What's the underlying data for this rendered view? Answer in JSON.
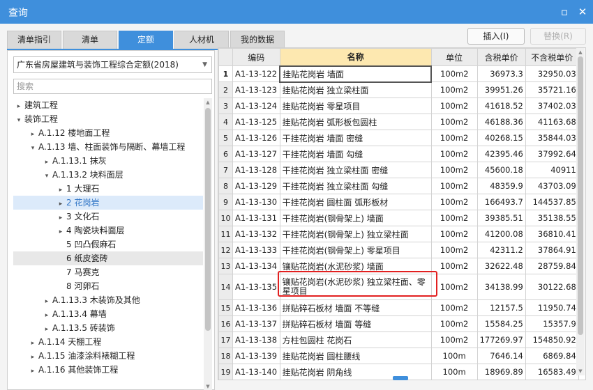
{
  "window": {
    "title": "查询",
    "restore_glyph": "▫",
    "close_glyph": "✕"
  },
  "tabs": [
    {
      "label": "清单指引"
    },
    {
      "label": "清单"
    },
    {
      "label": "定额",
      "active": true
    },
    {
      "label": "人材机"
    },
    {
      "label": "我的数据"
    }
  ],
  "buttons": {
    "insert": "插入(I)",
    "replace": "替换(R)"
  },
  "library": {
    "selected": "广东省房屋建筑与装饰工程综合定额(2018)"
  },
  "search": {
    "placeholder": "搜索",
    "value": ""
  },
  "tree": [
    {
      "label": "建筑工程",
      "level": 0,
      "toggle": "▸"
    },
    {
      "label": "装饰工程",
      "level": 0,
      "toggle": "▾"
    },
    {
      "label": "A.1.12 楼地面工程",
      "level": 1,
      "toggle": "▸"
    },
    {
      "label": "A.1.13 墙、柱面装饰与隔断、幕墙工程",
      "level": 1,
      "toggle": "▾"
    },
    {
      "label": "A.1.13.1 抹灰",
      "level": 2,
      "toggle": "▸"
    },
    {
      "label": "A.1.13.2 块料面层",
      "level": 2,
      "toggle": "▾"
    },
    {
      "label": "1 大理石",
      "level": 3,
      "toggle": "▸"
    },
    {
      "label": "2 花岗岩",
      "level": 3,
      "toggle": "▸",
      "selected": true
    },
    {
      "label": "3 文化石",
      "level": 3,
      "toggle": "▸"
    },
    {
      "label": "4 陶瓷块料面层",
      "level": 3,
      "toggle": "▸"
    },
    {
      "label": "5 凹凸假麻石",
      "level": 3,
      "toggle": ""
    },
    {
      "label": "6 纸皮瓷砖",
      "level": 3,
      "toggle": "",
      "hovered": true
    },
    {
      "label": "7 马赛克",
      "level": 3,
      "toggle": ""
    },
    {
      "label": "8 河卵石",
      "level": 3,
      "toggle": ""
    },
    {
      "label": "A.1.13.3 木装饰及其他",
      "level": 2,
      "toggle": "▸"
    },
    {
      "label": "A.1.13.4 幕墙",
      "level": 2,
      "toggle": "▸"
    },
    {
      "label": "A.1.13.5 砖装饰",
      "level": 2,
      "toggle": "▸"
    },
    {
      "label": "A.1.14 天棚工程",
      "level": 1,
      "toggle": "▸"
    },
    {
      "label": "A.1.15 油漆涂料裱糊工程",
      "level": 1,
      "toggle": "▸"
    },
    {
      "label": "A.1.16 其他装饰工程",
      "level": 1,
      "toggle": "▸"
    }
  ],
  "grid": {
    "headers": {
      "code": "编码",
      "name": "名称",
      "unit": "单位",
      "price_tax": "含税单价",
      "price_notax": "不含税单价"
    },
    "rows": [
      {
        "idx": "1",
        "code": "A1-13-122",
        "name": "挂贴花岗岩 墙面",
        "unit": "100m2",
        "price_tax": "36973.3",
        "price_notax": "32950.03"
      },
      {
        "idx": "2",
        "code": "A1-13-123",
        "name": "挂贴花岗岩 独立梁柱面",
        "unit": "100m2",
        "price_tax": "39951.26",
        "price_notax": "35721.16"
      },
      {
        "idx": "3",
        "code": "A1-13-124",
        "name": "挂贴花岗岩 零星项目",
        "unit": "100m2",
        "price_tax": "41618.52",
        "price_notax": "37402.03"
      },
      {
        "idx": "4",
        "code": "A1-13-125",
        "name": "挂贴花岗岩 弧形板包圆柱",
        "unit": "100m2",
        "price_tax": "46188.36",
        "price_notax": "41163.68"
      },
      {
        "idx": "5",
        "code": "A1-13-126",
        "name": "干挂花岗岩 墙面 密缝",
        "unit": "100m2",
        "price_tax": "40268.15",
        "price_notax": "35844.03"
      },
      {
        "idx": "6",
        "code": "A1-13-127",
        "name": "干挂花岗岩 墙面 勾缝",
        "unit": "100m2",
        "price_tax": "42395.46",
        "price_notax": "37992.64"
      },
      {
        "idx": "7",
        "code": "A1-13-128",
        "name": "干挂花岗岩 独立梁柱面 密缝",
        "unit": "100m2",
        "price_tax": "45600.18",
        "price_notax": "40911"
      },
      {
        "idx": "8",
        "code": "A1-13-129",
        "name": "干挂花岗岩 独立梁柱面 勾缝",
        "unit": "100m2",
        "price_tax": "48359.9",
        "price_notax": "43703.09"
      },
      {
        "idx": "9",
        "code": "A1-13-130",
        "name": "干挂花岗岩 圆柱面 弧形板材",
        "unit": "100m2",
        "price_tax": "166493.7",
        "price_notax": "144537.85"
      },
      {
        "idx": "10",
        "code": "A1-13-131",
        "name": "干挂花岗岩(钢骨架上) 墙面",
        "unit": "100m2",
        "price_tax": "39385.51",
        "price_notax": "35138.55"
      },
      {
        "idx": "11",
        "code": "A1-13-132",
        "name": "干挂花岗岩(钢骨架上) 独立梁柱面",
        "unit": "100m2",
        "price_tax": "41200.08",
        "price_notax": "36810.41"
      },
      {
        "idx": "12",
        "code": "A1-13-133",
        "name": "干挂花岗岩(钢骨架上) 零星项目",
        "unit": "100m2",
        "price_tax": "42311.2",
        "price_notax": "37864.91"
      },
      {
        "idx": "13",
        "code": "A1-13-134",
        "name": "镶贴花岗岩(水泥砂浆) 墙面",
        "unit": "100m2",
        "price_tax": "32622.48",
        "price_notax": "28759.84"
      },
      {
        "idx": "14",
        "code": "A1-13-135",
        "name": "镶贴花岗岩(水泥砂浆) 独立梁柱面、零星项目",
        "unit": "100m2",
        "price_tax": "34138.99",
        "price_notax": "30122.68",
        "tall": true
      },
      {
        "idx": "15",
        "code": "A1-13-136",
        "name": "拼贴碎石板材 墙面 不等缝",
        "unit": "100m2",
        "price_tax": "12157.5",
        "price_notax": "11950.74"
      },
      {
        "idx": "16",
        "code": "A1-13-137",
        "name": "拼贴碎石板材 墙面 等缝",
        "unit": "100m2",
        "price_tax": "15584.25",
        "price_notax": "15357.9"
      },
      {
        "idx": "17",
        "code": "A1-13-138",
        "name": "方柱包圆柱 花岗石",
        "unit": "100m2",
        "price_tax": "177269.97",
        "price_notax": "154850.92"
      },
      {
        "idx": "18",
        "code": "A1-13-139",
        "name": "挂贴花岗岩 圆柱腰线",
        "unit": "100m",
        "price_tax": "7646.14",
        "price_notax": "6869.84"
      },
      {
        "idx": "19",
        "code": "A1-13-140",
        "name": "挂贴花岗岩 阴角线",
        "unit": "100m",
        "price_tax": "18969.89",
        "price_notax": "16583.49"
      }
    ]
  },
  "highlighted_row": "14",
  "colors": {
    "accent": "#3f8fdc",
    "header_highlight": "#fde8b0",
    "annotation": "#e22020"
  }
}
